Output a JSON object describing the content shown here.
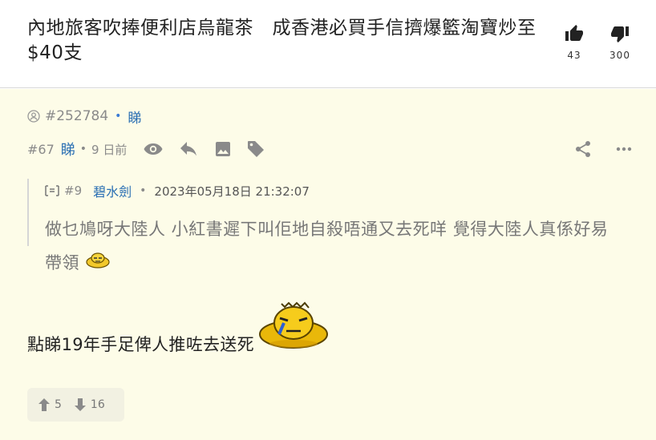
{
  "post": {
    "title": "內地旅客吹捧便利店烏龍茶　成香港必買手信擠爆籃淘寶炒至$40支",
    "likes": "43",
    "dislikes": "300"
  },
  "author": {
    "uid": "#252784",
    "name": "睇"
  },
  "reply": {
    "floor": "#67",
    "name": "睇",
    "time": "9 日前"
  },
  "quote": {
    "floor": "#9",
    "name": "碧水劍",
    "date": "2023年05月18日 21:32:07",
    "text": "做乜鳩呀大陸人 小紅書遲下叫佢地自殺唔通又去死咩 覺得大陸人真係好易帶領"
  },
  "body": {
    "text": "點睇19年手足俾人推咗去送死"
  },
  "footer": {
    "upvotes": "5",
    "downvotes": "16"
  },
  "colors": {
    "content_bg": "#fdfce8",
    "link": "#2a6fb3",
    "muted": "#8a8a8a"
  }
}
